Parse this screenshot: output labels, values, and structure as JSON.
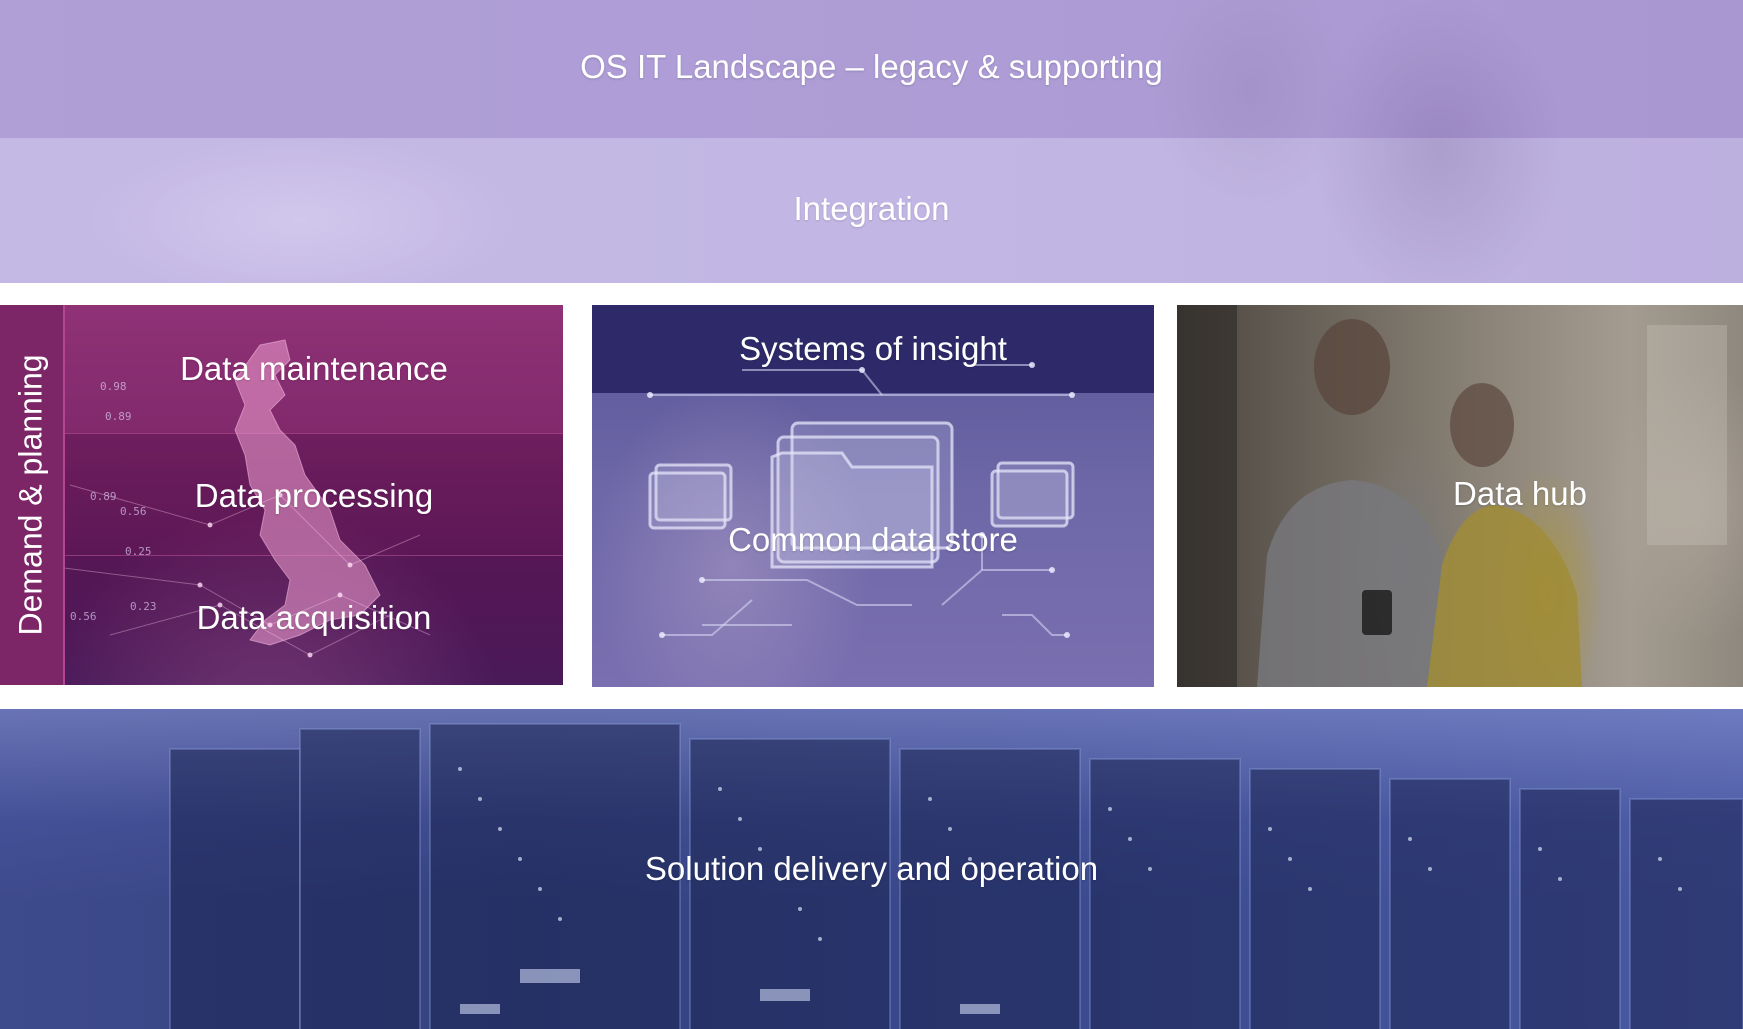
{
  "top_banner": {
    "title": "OS IT Landscape – legacy & supporting",
    "integration": "Integration"
  },
  "left_panel": {
    "sidebar_label": "Demand & planning",
    "rows": [
      "Data maintenance",
      "Data processing",
      "Data acquisition"
    ],
    "map_numbers": [
      "0.98",
      "0.89",
      "0.56",
      "0.89",
      "0.25",
      "0.23",
      "0.56"
    ]
  },
  "middle_panel": {
    "header": "Systems of insight",
    "center": "Common data store"
  },
  "right_panel": {
    "label": "Data hub"
  },
  "bottom_banner": {
    "label": "Solution delivery and operation"
  },
  "colors": {
    "top_banner": "#bdb0de",
    "left_panel": "#7c2668",
    "middle_header": "#2e2a6a",
    "middle_body": "#6e68a8",
    "bottom_banner": "#3b4a8e"
  }
}
